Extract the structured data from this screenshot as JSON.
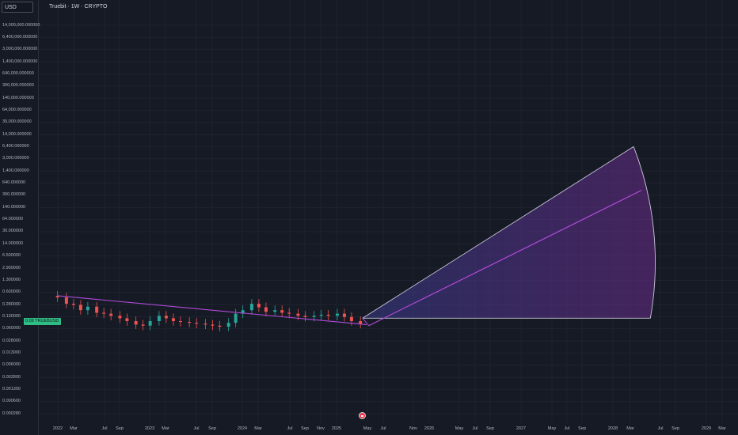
{
  "toolbar": {
    "currency": "USD"
  },
  "chart_data": {
    "type": "line",
    "title": "Truebit · 1W · CRYPTO",
    "y_scale": "log",
    "y_ticks": [
      "14,000,000.000000",
      "6,400,000.000000",
      "3,000,000.000000",
      "1,400,000.000000",
      "640,000.000000",
      "300,000.000000",
      "140,000.000000",
      "64,000.000000",
      "30,000.000000",
      "14,000.000000",
      "6,400.000000",
      "3,000.000000",
      "1,400.000000",
      "640.000000",
      "300.000000",
      "140.000000",
      "64.000000",
      "30.000000",
      "14.000000",
      "6.500000",
      "2.900000",
      "1.300000",
      "0.600000",
      "0.280000",
      "0.130000",
      "0.060000",
      "0.028000",
      "0.013000",
      "0.006000",
      "0.002800",
      "0.001300",
      "0.000600",
      "0.000280"
    ],
    "x_ticks": [
      "2022",
      "Mar",
      "Jul",
      "Sep",
      "2023",
      "Mar",
      "Jul",
      "Sep",
      "2024",
      "Mar",
      "Jul",
      "Sep",
      "Nov",
      "2025",
      "May",
      "Jul",
      "Nov",
      "2026",
      "May",
      "Jul",
      "Sep",
      "2027",
      "May",
      "Jul",
      "Sep",
      "2028",
      "Mar",
      "Jul",
      "Sep",
      "2029",
      "Mar"
    ],
    "price_label": {
      "symbol": "TRUEBUSD",
      "value": "0.09"
    },
    "price_series": {
      "x": [
        "2022-01-03",
        "2022-02-07",
        "2022-03-07",
        "2022-04-04",
        "2022-05-02",
        "2022-06-06",
        "2022-07-04",
        "2022-08-01",
        "2022-09-05",
        "2022-10-03",
        "2022-11-07",
        "2022-12-05",
        "2023-01-02",
        "2023-02-06",
        "2023-03-06",
        "2023-04-03",
        "2023-05-01",
        "2023-06-05",
        "2023-07-03",
        "2023-08-07",
        "2023-09-04",
        "2023-10-02",
        "2023-11-06",
        "2023-12-04",
        "2024-01-01",
        "2024-02-05",
        "2024-03-04",
        "2024-04-01",
        "2024-05-06",
        "2024-06-03",
        "2024-07-01",
        "2024-08-05",
        "2024-09-02",
        "2024-10-07",
        "2024-11-04",
        "2024-12-02",
        "2025-01-06",
        "2025-02-03",
        "2025-03-03",
        "2025-04-07"
      ],
      "y": [
        0.45,
        0.3,
        0.28,
        0.2,
        0.25,
        0.17,
        0.16,
        0.14,
        0.12,
        0.1,
        0.08,
        0.075,
        0.1,
        0.14,
        0.12,
        0.1,
        0.095,
        0.09,
        0.085,
        0.08,
        0.075,
        0.07,
        0.09,
        0.16,
        0.2,
        0.3,
        0.24,
        0.18,
        0.2,
        0.17,
        0.16,
        0.14,
        0.13,
        0.14,
        0.15,
        0.14,
        0.16,
        0.13,
        0.1,
        0.085
      ]
    },
    "trendline": {
      "from": [
        "2022-01-03",
        0.5
      ],
      "to": [
        "2025-05-01",
        0.08
      ]
    },
    "fan": {
      "apex": [
        "2025-04-15",
        0.12
      ],
      "upper": [
        "2028-03-15",
        6400
      ],
      "middle": [
        "2028-04-15",
        400
      ],
      "base": [
        "2028-05-20",
        0.12
      ],
      "low_point": [
        "2025-05-10",
        0.075
      ],
      "color_fill": "#5b4bb5",
      "color_line": "#b04ad8",
      "color_edge": "#c9c8d8"
    },
    "colors": {
      "up": "#26a69a",
      "down": "#ef5350",
      "trend": "#b04ad8"
    }
  }
}
